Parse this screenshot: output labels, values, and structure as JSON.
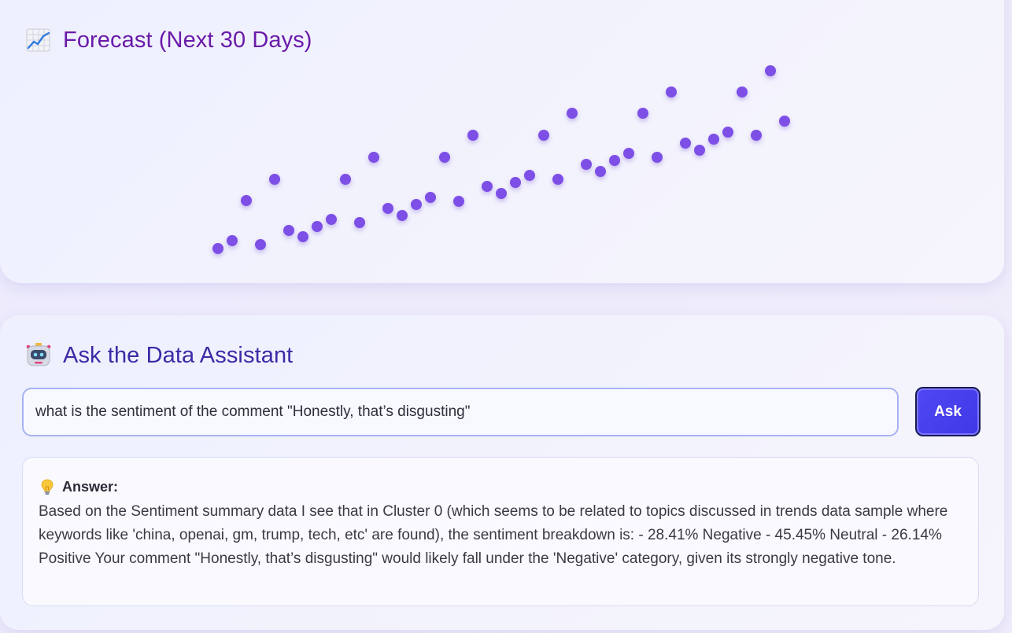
{
  "forecast": {
    "title": "Forecast (Next 30 Days)",
    "icon": "chart-increasing-icon"
  },
  "chart_data": {
    "type": "scatter",
    "title": "",
    "xlabel": "",
    "ylabel": "",
    "grid": false,
    "marker_color": "#7d4fe6",
    "series": [
      {
        "values": [
          316,
          306,
          255,
          311,
          228,
          293,
          301,
          288,
          279,
          228,
          283,
          200,
          265,
          274,
          260,
          251,
          200,
          256,
          172,
          237,
          246,
          232,
          223,
          172,
          228,
          144,
          209,
          218,
          204,
          195,
          144,
          200,
          117,
          182,
          191,
          177,
          168,
          117,
          172,
          90,
          154
        ],
        "x": [
          0,
          1,
          2,
          3,
          4,
          5,
          6,
          7,
          8,
          9,
          10,
          11,
          12,
          13,
          14,
          15,
          16,
          17,
          18,
          19,
          20,
          21,
          22,
          23,
          24,
          25,
          26,
          27,
          28,
          29,
          30,
          31,
          32,
          33,
          34,
          35,
          36,
          37,
          38,
          39,
          40
        ]
      }
    ]
  },
  "assistant": {
    "title": "Ask the Data Assistant",
    "icon": "robot-icon",
    "input_value": "what is the sentiment of the comment \"Honestly, that’s disgusting\"",
    "ask_label": "Ask",
    "answer_icon": "light-bulb-icon",
    "answer_label": "Answer:",
    "answer_text": "Based on the Sentiment summary data I see that in Cluster 0 (which seems to be related to topics discussed in trends data sample where keywords like 'china, openai, gm, trump, tech, etc' are found), the sentiment breakdown is: - 28.41% Negative - 45.45% Neutral - 26.14% Positive Your comment \"Honestly, that’s disgusting\" would likely fall under the 'Negative' category, given its strongly negative tone.",
    "colors": {
      "button": "#4a40ee",
      "input_border": "#a7b3f3",
      "forecast_title": "#6a1aa8",
      "assistant_title": "#3a2aa6"
    }
  }
}
